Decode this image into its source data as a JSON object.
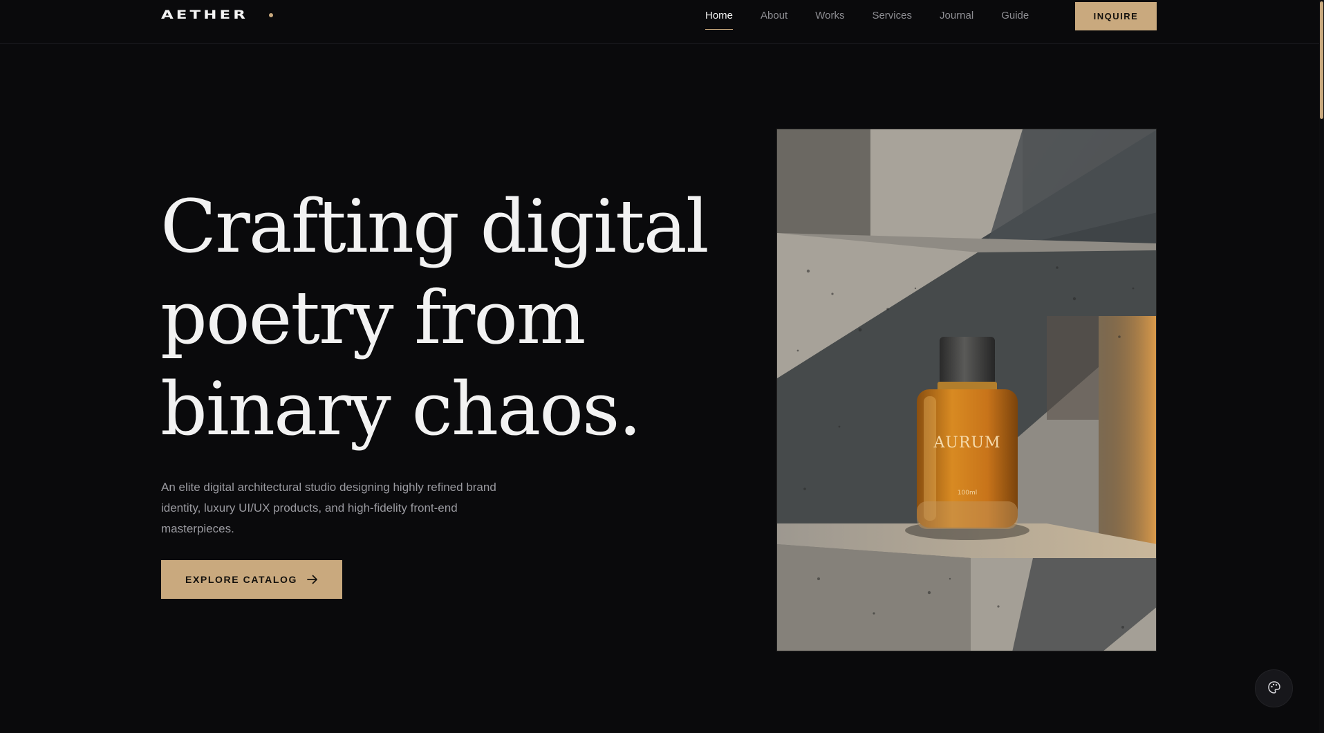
{
  "brand": {
    "name": "AETHER"
  },
  "nav": {
    "items": [
      {
        "label": "Home",
        "active": true
      },
      {
        "label": "About",
        "active": false
      },
      {
        "label": "Works",
        "active": false
      },
      {
        "label": "Services",
        "active": false
      },
      {
        "label": "Journal",
        "active": false
      },
      {
        "label": "Guide",
        "active": false
      }
    ],
    "cta_label": "INQUIRE"
  },
  "hero": {
    "title_lines": [
      "Crafting digital",
      "poetry from",
      "binary chaos."
    ],
    "description": "An elite digital architectural studio designing highly refined brand identity, luxury UI/UX products, and high-fidelity front-end masterpieces.",
    "cta_label": "EXPLORE CATALOG",
    "cta_icon": "arrow-right-icon"
  },
  "product_image": {
    "bottle_label": "AURUM",
    "bottle_volume": "100ml"
  },
  "floating_widget": {
    "icon": "palette-icon"
  },
  "colors": {
    "accent": "#c9a97e",
    "background": "#0a0a0c",
    "text_primary": "#f2f2f2",
    "text_muted": "#9a9aa0"
  }
}
